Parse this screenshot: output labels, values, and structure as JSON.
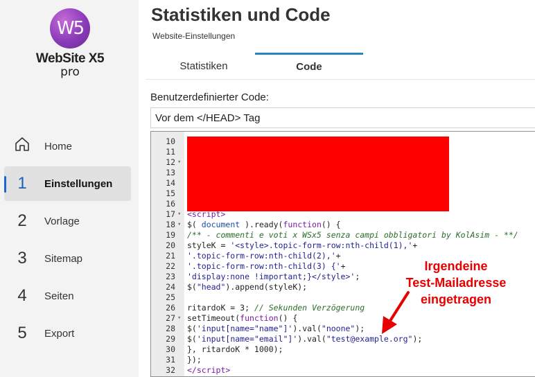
{
  "sidebar": {
    "logo": {
      "mark": "W5",
      "name": "WebSite X5",
      "edition": "pro"
    },
    "items": [
      {
        "num": "",
        "label": "Home",
        "icon": "home-icon"
      },
      {
        "num": "1",
        "label": "Einstellungen"
      },
      {
        "num": "2",
        "label": "Vorlage"
      },
      {
        "num": "3",
        "label": "Sitemap"
      },
      {
        "num": "4",
        "label": "Seiten"
      },
      {
        "num": "5",
        "label": "Export"
      }
    ]
  },
  "header": {
    "title": "Statistiken und Code",
    "subtitle": "Website-Einstellungen"
  },
  "tabs": [
    {
      "label": "Statistiken"
    },
    {
      "label": "Code"
    }
  ],
  "main": {
    "custom_code_label": "Benutzerdefinierter Code:",
    "position_select": "Vor dem </HEAD> Tag"
  },
  "annotation": {
    "line1": "Irgendeine",
    "line2": "Test-Mailadresse",
    "line3": "eingetragen"
  },
  "colors": {
    "accent": "#1e66c9",
    "annotation": "#e60000",
    "redaction": "#ff0000"
  }
}
